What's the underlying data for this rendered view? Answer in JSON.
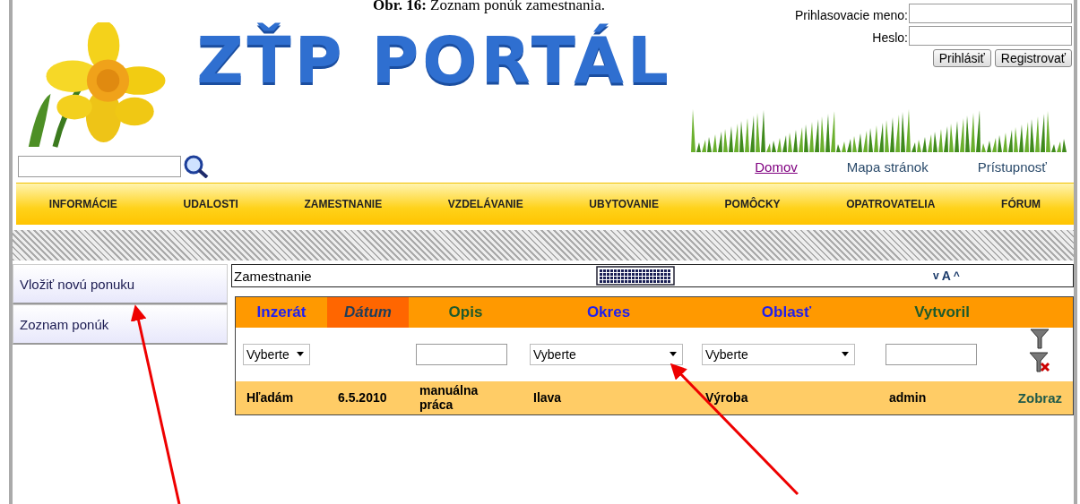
{
  "caption": "**Obr. 16:** Zoznam ponúk zamestnania.",
  "logo": "ZŤP PORTÁL",
  "login": {
    "username_label": "Prihlasovacie meno:",
    "password_label": "Heslo:",
    "buttons": [
      "Prihlásiť",
      "Registrovať"
    ]
  },
  "top_links": [
    {
      "label": "Domov",
      "visited": true
    },
    {
      "label": "Mapa stránok",
      "visited": false
    },
    {
      "label": "Prístupnosť",
      "visited": false
    }
  ],
  "nav": [
    "INFORMÁCIE",
    "UDALOSTI",
    "ZAMESTNANIE",
    "VZDELÁVANIE",
    "UBYTOVANIE",
    "POMÔCKY",
    "OPATROVATELIA",
    "FÓRUM"
  ],
  "sidebar": {
    "items": [
      "Vložiť novú ponuku",
      "Zoznam ponúk"
    ]
  },
  "toolbar": {
    "title": "Zamestnanie",
    "font_controls": [
      "v",
      "A",
      "^"
    ]
  },
  "table": {
    "columns": [
      {
        "label": "Inzerát",
        "kind": "link",
        "selected": false,
        "filter": {
          "kind": "select",
          "value": "Vyberte"
        }
      },
      {
        "label": "Dátum",
        "kind": "link",
        "selected": true
      },
      {
        "label": "Opis",
        "kind": "text",
        "selected": false,
        "filter": {
          "kind": "input"
        }
      },
      {
        "label": "Okres",
        "kind": "link",
        "selected": false,
        "filter": {
          "kind": "select",
          "value": "Vyberte"
        }
      },
      {
        "label": "Oblasť",
        "kind": "link",
        "selected": false,
        "filter": {
          "kind": "select",
          "value": "Vyberte"
        }
      },
      {
        "label": "Vytvoril",
        "kind": "text",
        "selected": false,
        "filter": {
          "kind": "input"
        }
      }
    ],
    "rows": [
      {
        "cells": [
          "Hľadám",
          "6.5.2010",
          "manuálna práca",
          "Ilava",
          "Výroba",
          "admin"
        ],
        "action": "Zobraz"
      }
    ]
  }
}
